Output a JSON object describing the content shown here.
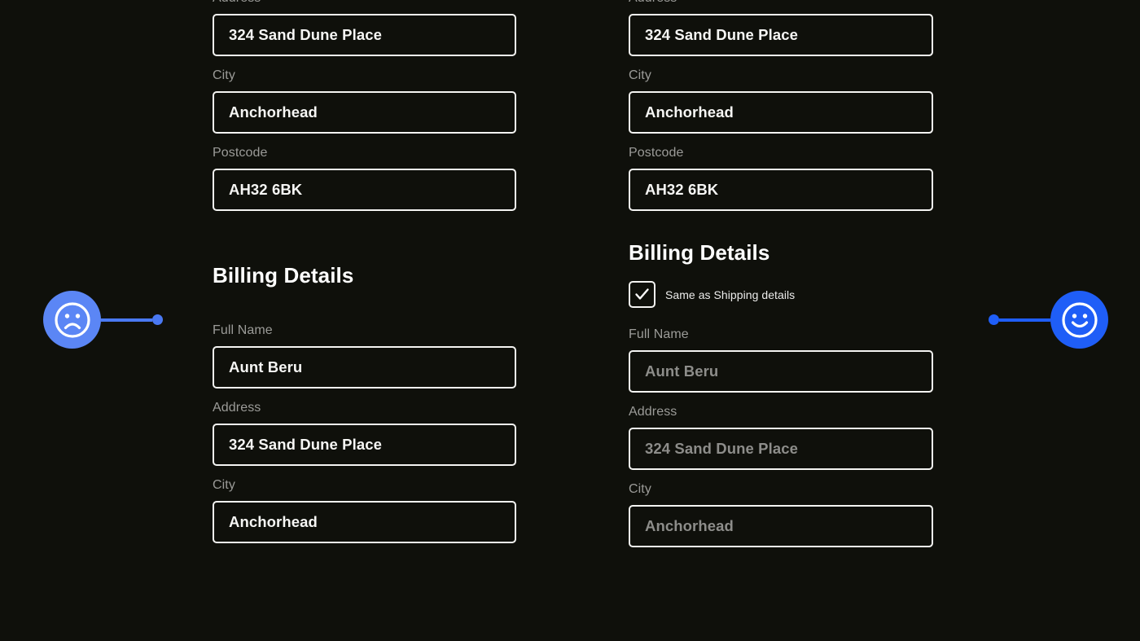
{
  "theme": {
    "background": "#0f100b",
    "field_border": "#f4f4f2",
    "label_color": "#9b9b98",
    "value_color": "#f6f6f4",
    "disabled_value_color": "#8d8d8a",
    "marker_sad_color": "#5b86f5",
    "marker_happy_color": "#1f5ef7"
  },
  "left_panel": {
    "shipping_fields": [
      {
        "label": "Address",
        "value": "324 Sand Dune Place"
      },
      {
        "label": "City",
        "value": "Anchorhead"
      },
      {
        "label": "Postcode",
        "value": "AH32 6BK"
      }
    ],
    "billing_heading": "Billing Details",
    "billing_fields": [
      {
        "label": "Full Name",
        "value": "Aunt Beru"
      },
      {
        "label": "Address",
        "value": "324 Sand Dune Place"
      },
      {
        "label": "City",
        "value": "Anchorhead"
      }
    ]
  },
  "right_panel": {
    "shipping_fields": [
      {
        "label": "Address",
        "value": "324 Sand Dune Place"
      },
      {
        "label": "City",
        "value": "Anchorhead"
      },
      {
        "label": "Postcode",
        "value": "AH32 6BK"
      }
    ],
    "billing_heading": "Billing Details",
    "same_as_shipping": {
      "label": "Same as Shipping details",
      "checked": true
    },
    "billing_fields": [
      {
        "label": "Full Name",
        "value": "Aunt Beru"
      },
      {
        "label": "Address",
        "value": "324 Sand Dune Place"
      },
      {
        "label": "City",
        "value": "Anchorhead"
      }
    ]
  },
  "markers": {
    "left": {
      "icon": "frowning-face-icon",
      "sentiment": "negative"
    },
    "right": {
      "icon": "smiling-face-icon",
      "sentiment": "positive"
    }
  }
}
